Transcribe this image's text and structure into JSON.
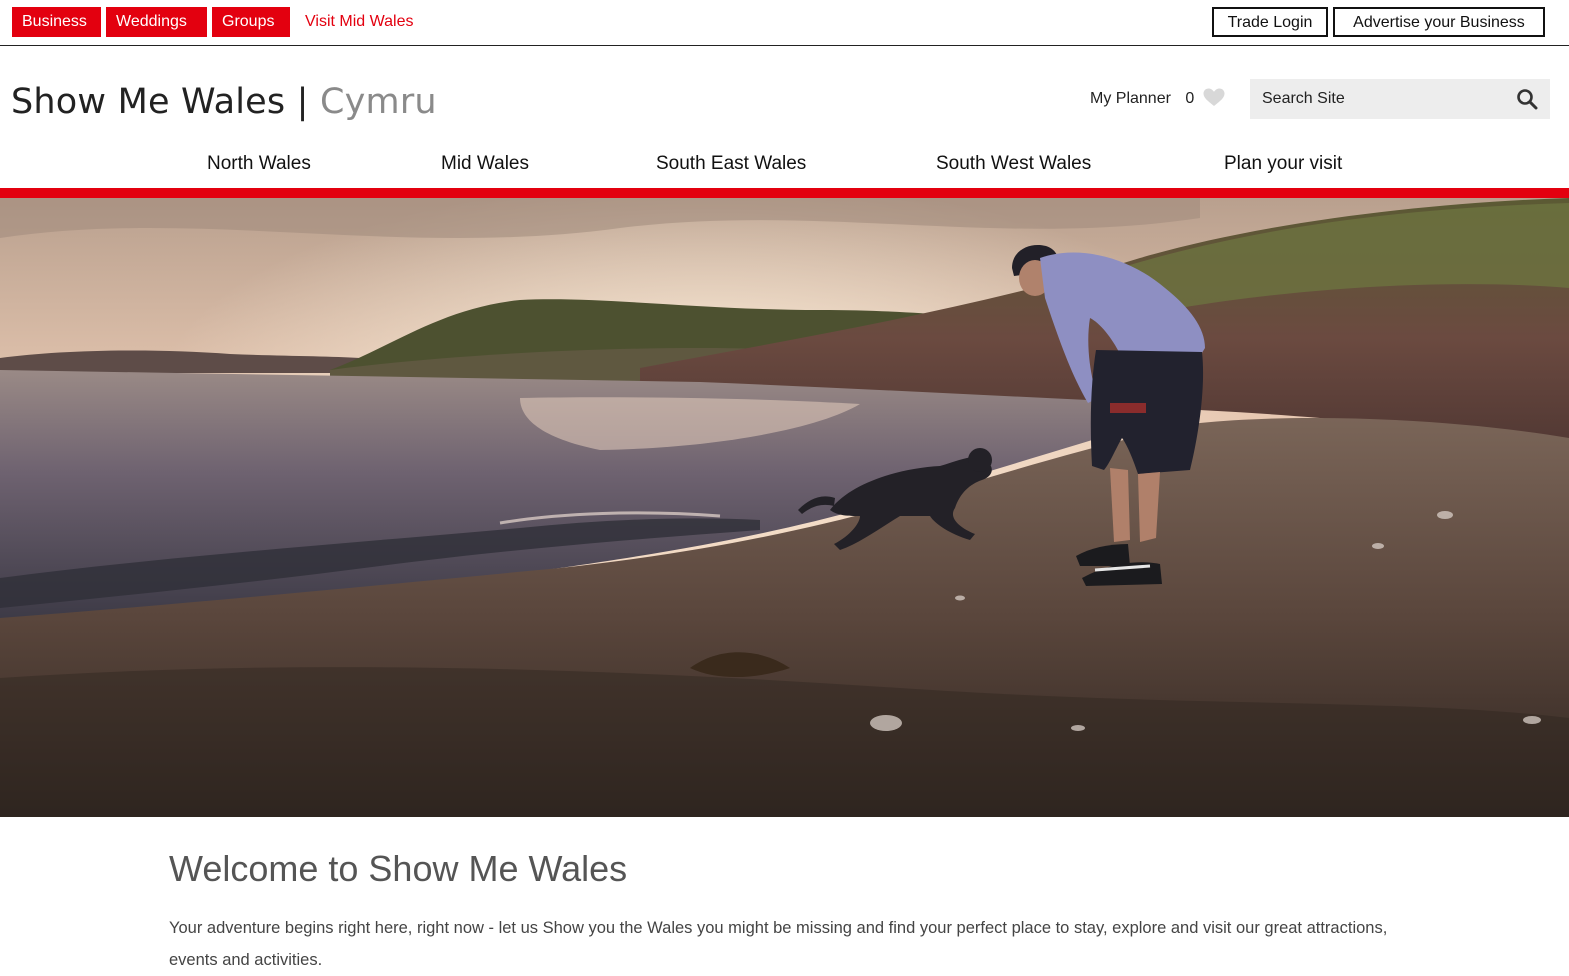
{
  "topbar": {
    "tags": [
      "Business",
      "Weddings",
      "Groups"
    ],
    "visit_link": "Visit Mid Wales",
    "trade_login": "Trade Login",
    "advertise": "Advertise your Business"
  },
  "header": {
    "logo_main": "Show Me Wales",
    "logo_separator": "|",
    "logo_suffix": "Cymru",
    "planner_label": "My Planner",
    "planner_count": "0",
    "search_placeholder": "Search Site"
  },
  "nav": {
    "items": [
      "North Wales",
      "Mid Wales",
      "South East Wales",
      "South West Wales",
      "Plan your visit"
    ]
  },
  "welcome": {
    "title": "Welcome to Show Me Wales",
    "text": "Your adventure begins right here, right now - let us Show you the Wales you might be missing and find your perfect place to stay, explore and visit our great attractions, events and activities."
  },
  "colors": {
    "brand_red": "#e3000f",
    "text_dark": "#111111",
    "search_bg": "#ededed"
  },
  "icons": {
    "planner": "heart-icon",
    "search": "search-icon"
  }
}
